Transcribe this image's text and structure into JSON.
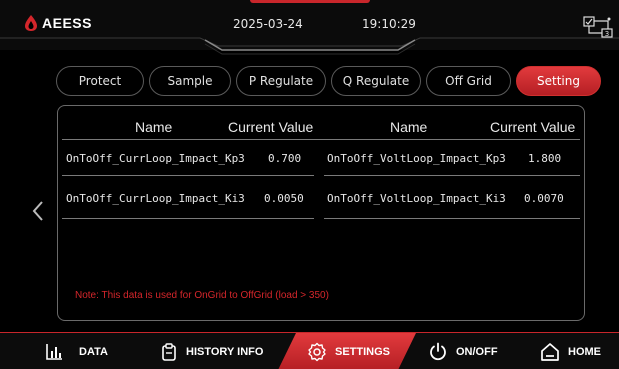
{
  "header": {
    "logo_text": "AEESS",
    "date": "2025-03-24",
    "time": "19:10:29",
    "icons": [
      "logo-mark-icon",
      "system-diagram-icon"
    ]
  },
  "tabs": [
    {
      "label": "Protect",
      "active": false
    },
    {
      "label": "Sample",
      "active": false
    },
    {
      "label": "P Regulate",
      "active": false
    },
    {
      "label": "Q Regulate",
      "active": false
    },
    {
      "label": "Off Grid",
      "active": false
    },
    {
      "label": "Setting",
      "active": true
    }
  ],
  "table": {
    "headers": {
      "name_left": "Name",
      "value_left": "Current Value",
      "name_right": "Name",
      "value_right": "Current Value"
    },
    "rows": [
      {
        "name_left": "OnToOff_CurrLoop_Impact_Kp3",
        "value_left": "0.700",
        "name_right": "OnToOff_VoltLoop_Impact_Kp3",
        "value_right": "1.800"
      },
      {
        "name_left": "OnToOff_CurrLoop_Impact_Ki3",
        "value_left": "0.0050",
        "name_right": "OnToOff_VoltLoop_Impact_Ki3",
        "value_right": "0.0070"
      }
    ]
  },
  "note": "Note: This data is used for OnGrid to OffGrid (load > 350)",
  "bottom_nav": [
    {
      "label": "DATA",
      "icon": "bar-chart-icon",
      "active": false
    },
    {
      "label": "HISTORY INFO",
      "icon": "clipboard-icon",
      "active": false
    },
    {
      "label": "SETTINGS",
      "icon": "gear-icon",
      "active": true
    },
    {
      "label": "ON/OFF",
      "icon": "power-icon",
      "active": false
    },
    {
      "label": "HOME",
      "icon": "home-icon",
      "active": false
    }
  ],
  "colors": {
    "accent": "#c8262b",
    "background": "#000000",
    "note": "#d4262b"
  }
}
